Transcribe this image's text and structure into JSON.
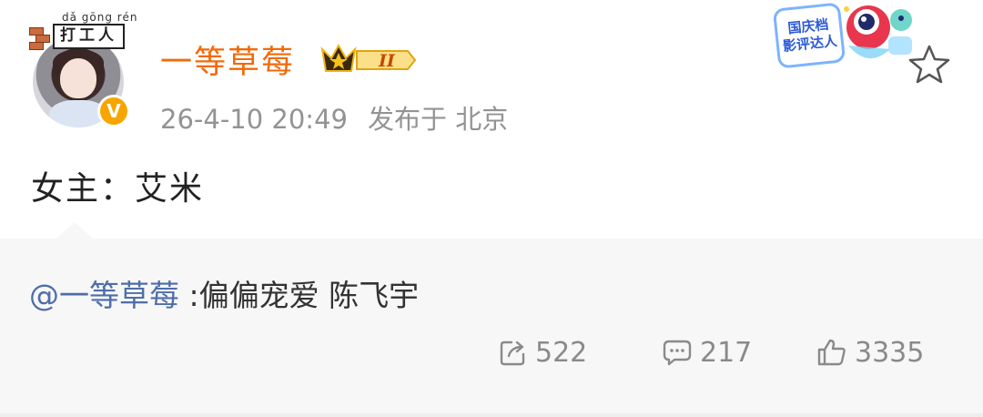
{
  "post": {
    "avatar_badge": {
      "pinyin": "dǎ gōng rén",
      "chars": "打工人"
    },
    "verified_mark": "V",
    "username": "一等草莓",
    "level_badge": "II",
    "timestamp": "26-4-10 20:49",
    "location": "发布于 北京",
    "event_badge": {
      "line1": "国庆档",
      "line2": "影评达人"
    },
    "content": "女主：艾米",
    "colors": {
      "username": "#f26a08",
      "meta": "#939393",
      "verified": "#f7a600"
    }
  },
  "repost": {
    "mention": "@一等草莓",
    "text": " :偏偏宠爱 陈飞宇",
    "mention_color": "#4e6ea8"
  },
  "actions": {
    "share_icon": "share-icon",
    "share_count": "522",
    "comment_icon": "comment-icon",
    "comment_count": "217",
    "like_icon": "thumbs-up-icon",
    "like_count": "3335"
  }
}
